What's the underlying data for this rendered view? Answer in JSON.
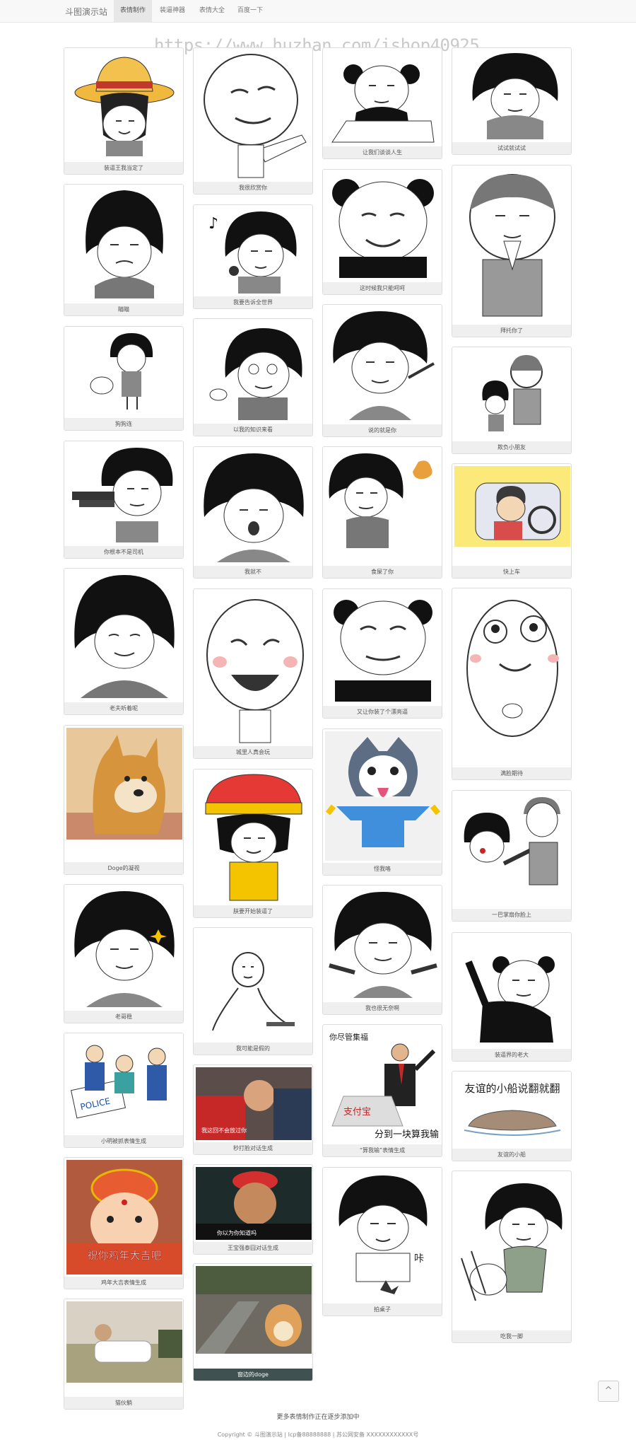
{
  "header": {
    "brand": "斗图演示站",
    "nav": [
      "表情制作",
      "装逼神器",
      "表情大全",
      "百度一下"
    ]
  },
  "watermark": "https://www.huzhan.com/ishop40925",
  "cards": [
    "装逼王我当定了",
    "瞄瞄",
    "狗狗连",
    "你根本不是司机",
    "老夫听着呢",
    "Doge的凝视",
    "老哥稳",
    "小明被抓表情生成",
    "鸡年大吉表情生成",
    "猫伙躺",
    "我很欣赏你",
    "我要告诉全世界",
    "以我的知识来看",
    "我就不",
    "城里人真会玩",
    "朕要开始装逼了",
    "我可能是假的",
    "秒打脸对话生成",
    "王宝强泰囧对话生成",
    "窗边的doge",
    "让我们谈谈人生",
    "这时候我只能呵呵",
    "说的就是你",
    "食屎了你",
    "又让你装了个漂亮逼",
    "怪我咯",
    "我也很无奈啊",
    "“算我输”表情生成",
    "拍桌子",
    "试试就试试",
    "拜托你了",
    "欺负小朋友",
    "快上车",
    "满脸期待",
    "一巴掌扇你脸上",
    "装逼界的老大",
    "友谊的小船",
    "吃我一脚"
  ],
  "image_text": {
    "alipay_top": "你尽管集福",
    "alipay_logo": "支付宝",
    "alipay_bottom": "分到一块算我输",
    "boat": "友谊的小船说翻就翻",
    "chicken": "祝你鸡年大吉吧",
    "police": "POLICE",
    "sound": "咔",
    "sub1": "我这回不会放过你",
    "sub2": "你以为你知道吗"
  },
  "footer": {
    "more": "更多表情制作正在逐步添加中",
    "copyright": "Copyright © 斗图演示站 | Icp备88888888 | 苏公网安备 XXXXXXXXXXXX号"
  },
  "back_to_top": "^"
}
